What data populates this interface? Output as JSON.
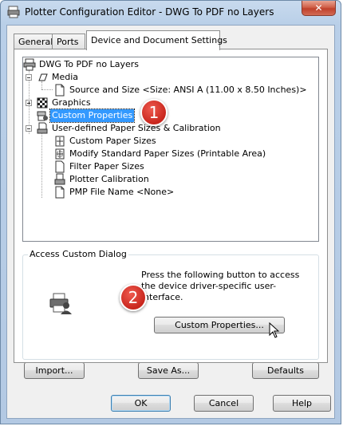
{
  "window": {
    "title": "Plotter Configuration Editor - DWG To PDF no Layers",
    "close_glyph": "✕"
  },
  "tabs": [
    {
      "label": "General",
      "active": false
    },
    {
      "label": "Ports",
      "active": false
    },
    {
      "label": "Device and Document Settings",
      "active": true
    }
  ],
  "tree": {
    "root": "DWG To PDF no Layers",
    "media": "Media",
    "source_and_size": "Source and Size <Size: ANSI A (11.00 x 8.50 Inches)>",
    "graphics": "Graphics",
    "custom_properties": "Custom Properties",
    "user_defined": "User-defined Paper Sizes & Calibration",
    "custom_paper_sizes": "Custom Paper Sizes",
    "modify_standard": "Modify Standard Paper Sizes (Printable Area)",
    "filter_paper_sizes": "Filter Paper Sizes",
    "plotter_calibration": "Plotter Calibration",
    "pmp_file_name": "PMP File Name <None>"
  },
  "group": {
    "title": "Access Custom Dialog",
    "description": "Press the following button to access the device driver-specific user-interface.",
    "custom_properties_button": "Custom Properties..."
  },
  "buttons": {
    "import": "Import...",
    "save_as": "Save As...",
    "defaults": "Defaults",
    "ok": "OK",
    "cancel": "Cancel",
    "help": "Help"
  },
  "callouts": {
    "one": "1",
    "two": "2"
  },
  "colors": {
    "selection": "#3399ff",
    "callout": "#d0342a"
  }
}
